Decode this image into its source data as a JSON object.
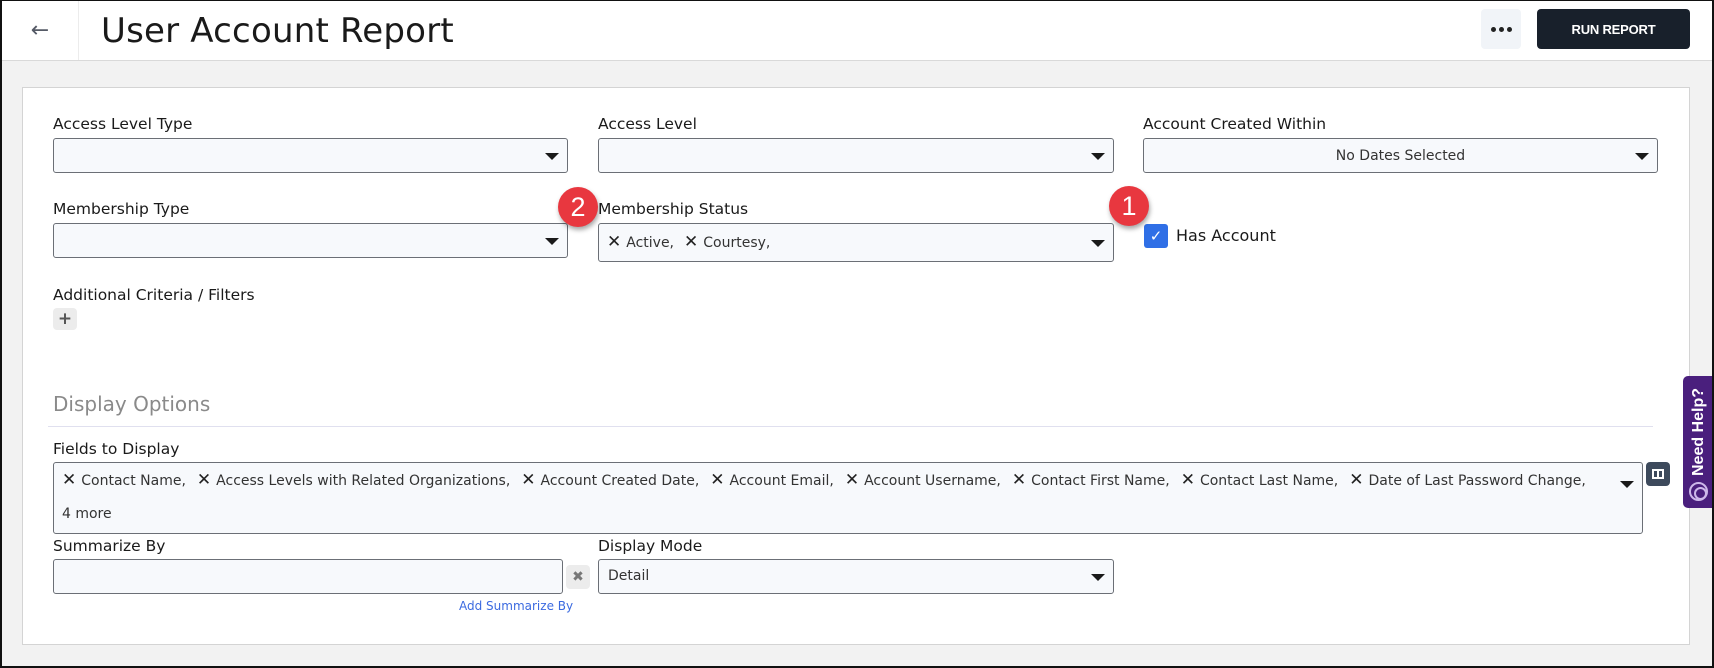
{
  "header": {
    "back_icon": "arrow-left-icon",
    "title": "User Account Report",
    "more_icon": "ellipsis-icon",
    "run_report_label": "RUN REPORT"
  },
  "filters": {
    "access_level_type": {
      "label": "Access Level Type",
      "value": ""
    },
    "access_level": {
      "label": "Access Level",
      "value": ""
    },
    "account_created_within": {
      "label": "Account Created Within",
      "value": "No Dates Selected"
    },
    "membership_type": {
      "label": "Membership Type",
      "value": ""
    },
    "membership_status": {
      "label": "Membership Status",
      "selected": [
        "Active,",
        "Courtesy,"
      ]
    },
    "has_account": {
      "label": "Has Account",
      "checked": true
    },
    "additional_criteria": {
      "label": "Additional Criteria / Filters",
      "add_icon": "plus-icon"
    }
  },
  "annotations": {
    "badge_1": "1",
    "badge_2": "2",
    "badge_color": "#e8373f"
  },
  "display_options": {
    "section_title": "Display Options",
    "fields_to_display": {
      "label": "Fields to Display",
      "selected": [
        "Contact Name,",
        "Access Levels with Related Organizations,",
        "Account Created Date,",
        "Account Email,",
        "Account Username,",
        "Contact First Name,",
        "Contact Last Name,",
        "Date of Last Password Change,"
      ],
      "more_text": "4 more"
    },
    "summarize_by": {
      "label": "Summarize By",
      "value": "",
      "add_link": "Add Summarize By"
    },
    "display_mode": {
      "label": "Display Mode",
      "value": "Detail"
    }
  },
  "help_tab": {
    "label": "Need Help?",
    "icon": "lifebuoy-icon",
    "color": "#4a1f7d"
  },
  "colors": {
    "run_button": "#18202b",
    "checkbox": "#2f6fe6",
    "link": "#3b6ae0"
  }
}
